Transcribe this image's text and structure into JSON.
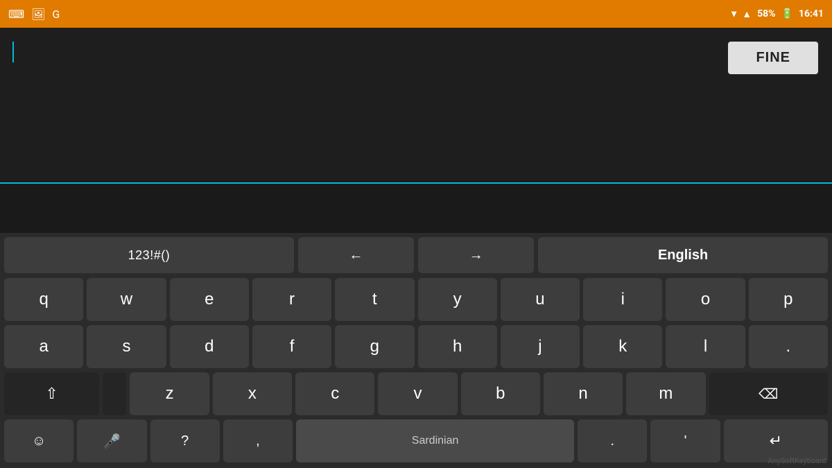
{
  "statusBar": {
    "battery": "58%",
    "time": "16:41"
  },
  "textArea": {
    "placeholder": ""
  },
  "fineButton": {
    "label": "FINE"
  },
  "keyboard": {
    "topRow": {
      "numbers": "123!#()",
      "arrowLeft": "←",
      "arrowRight": "→",
      "language": "English"
    },
    "row1": [
      "q",
      "w",
      "e",
      "r",
      "t",
      "y",
      "u",
      "i",
      "o",
      "p"
    ],
    "row2": [
      "a",
      "s",
      "d",
      "f",
      "g",
      "h",
      "j",
      "k",
      "l",
      "."
    ],
    "row3": [
      "z",
      "x",
      "c",
      "v",
      "b",
      "n",
      "m"
    ],
    "bottomRow": {
      "question": "?",
      "comma": ",",
      "spaceLabel": "Sardinian",
      "periodSm": ".",
      "quote": "'"
    },
    "watermark": "AnySoftKeyboard"
  }
}
